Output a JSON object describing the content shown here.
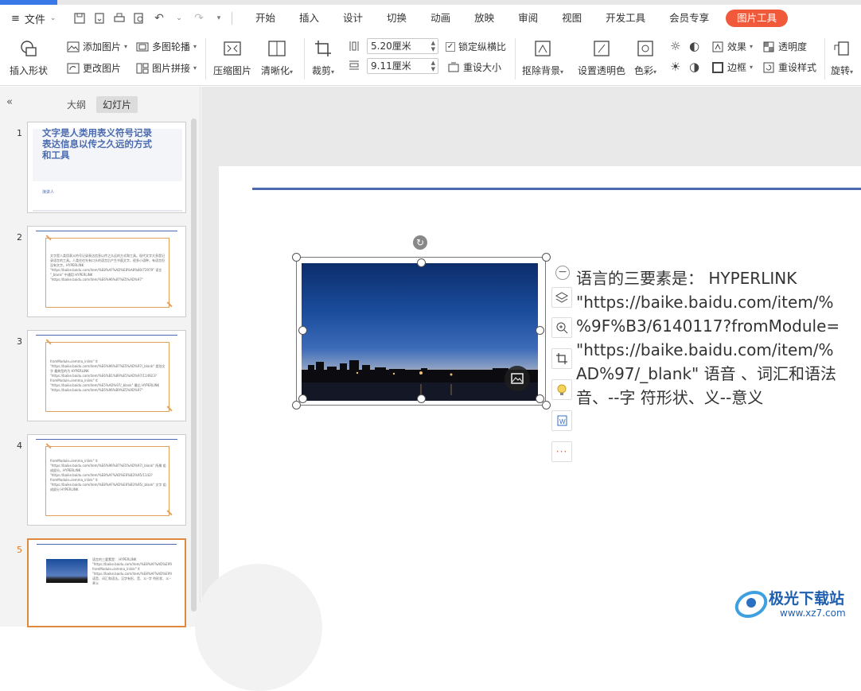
{
  "menu": {
    "file_label": "文件",
    "tabs": [
      "开始",
      "插入",
      "设计",
      "切换",
      "动画",
      "放映",
      "审阅",
      "视图",
      "开发工具",
      "会员专享"
    ],
    "active_tab": "图片工具"
  },
  "ribbon": {
    "insert_shape": "插入形状",
    "add_picture": "添加图片",
    "multi_carousel": "多图轮播",
    "change_picture": "更改图片",
    "picture_collage": "图片拼接",
    "compress_picture": "压缩图片",
    "sharpen": "清晰化",
    "crop": "裁剪",
    "height_value": "5.20厘米",
    "width_value": "9.11厘米",
    "lock_ratio": "锁定纵横比",
    "reset_size": "重设大小",
    "remove_background": "抠除背景",
    "set_transparent_color": "设置透明色",
    "color": "色彩",
    "effects": "效果",
    "transparency": "透明度",
    "border": "边框",
    "reset_style": "重设样式",
    "rotate": "旋转"
  },
  "panel": {
    "collapse_icon": "«",
    "tab_outline": "大纲",
    "tab_slides": "幻灯片",
    "slides": [
      {
        "num": "1",
        "title": "文字是人类用表义符号记录表达信息以传之久远的方式和工具",
        "subtitle": "演讲人"
      },
      {
        "num": "2",
        "text": "文字是人类用表义符号记录表达信息以传之久远的方式和工具。现代文字大多是记录语言的工具。人类往往先有口头的语言后产生书面文字，很多小语种，有语言但没有文字。HYPERLINK \"https://baike.baidu.com/item/%E8%AF%AD%E8%A8%80/72979\" 语言 \"_blank\" 中通用 HYPERLINK \"https://baike.baidu.com/item/%E6%96%87%E5%AD%97\""
      },
      {
        "num": "3",
        "text": "fromModule=lemma_inlink\" \\t \"https://baike.baidu.com/item/%E6%96%87%E5%AD%97/_blank\" 类别文字 最典型的为 HYPERLINK \"https://baike.baidu.com/item/%E6%B1%89%E5%AD%97/114923?fromModule=lemma_inlink\" \\t \"https://baike.baidu.com/item/%E5%AD%97/_blank\" 最后 HYPERLINK \"https://baike.baidu.com/item/%E6%96%B9%E5%9D%97\""
      },
      {
        "num": "4",
        "text": "fromModule=lemma_inlink\" \\t \"https://baike.baidu.com/item/%E6%96%87%E5%AD%97/_blank\" 所属 组成部分。HYPERLINK \"https://baike.baidu.com/item/%E8%AF%AD%E6%B3%95/1142?fromModule=lemma_inlink\" \\t \"https://baike.baidu.com/item/%E8%AF%AD%E6%B3%95/_blank\" 文字 组成部分 HYPERLINK"
      },
      {
        "num": "5",
        "text": "语言的三要素是： HYPERLINK \"https://baike.baidu.com/item/%E8%AF%AD%E9%9F%B3/6140117?fromModule=lemma_inlink\" \\t \"https://baike.baidu.com/item/%E8%AF%AD%E9%9F%B3/_blank\" 语音、词汇和语法。汉字有形、音、义--字 符形状、义--意义"
      }
    ]
  },
  "slide": {
    "body_text": "语言的三要素是： HYPERLINK\n\"https://baike.baidu.com/item/%\n%9F%B3/6140117?fromModule=\n\"https://baike.baidu.com/item/%\nAD%97/_blank\" 语音 、词汇和语法\n音、--字 符形状、义--意义"
  },
  "watermark": {
    "name": "极光下载站",
    "url": "www.xz7.com"
  },
  "colors": {
    "accent_tab": "#f05a3a",
    "slide_line": "#4a6bb0",
    "thumb_frame": "#e3a25c"
  }
}
